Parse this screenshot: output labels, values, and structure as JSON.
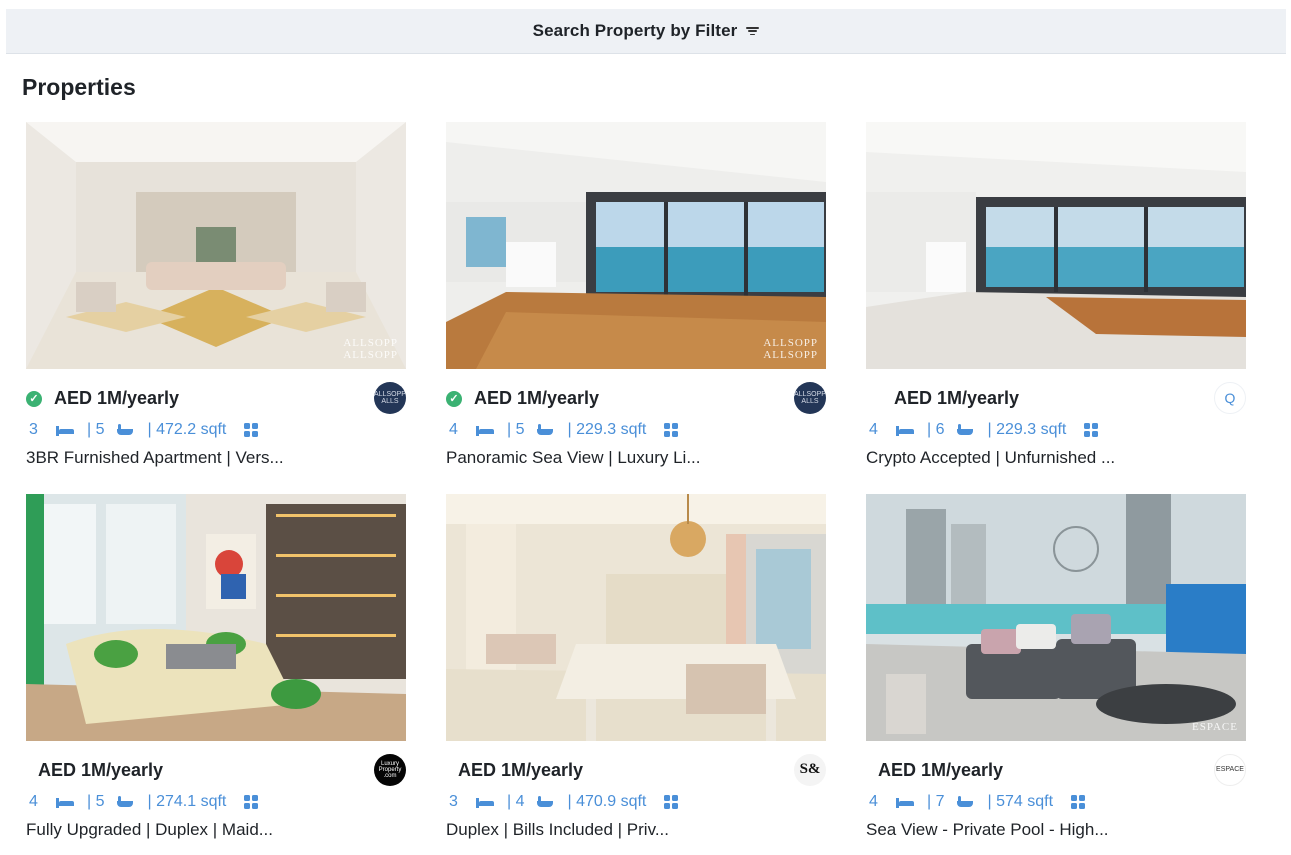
{
  "filter_bar": {
    "label": "Search Property by Filter",
    "icon": "filter-lines-icon"
  },
  "heading": "Properties",
  "accent_color": "#4a8fd8",
  "listings": [
    {
      "price": "AED 1M/yearly",
      "verified": true,
      "beds": "3",
      "baths": "| 5",
      "area": "| 472.2 sqft",
      "title": "3BR Furnished Apartment | Vers...",
      "agency_text": "ALLSOPP\nALLS",
      "photo_watermark": "ALLSOPP\nALLSOPP"
    },
    {
      "price": "AED 1M/yearly",
      "verified": true,
      "beds": "4",
      "baths": "| 5",
      "area": "| 229.3 sqft",
      "title": "Panoramic Sea View | Luxury Li...",
      "agency_text": "ALLSOPP\nALLS",
      "photo_watermark": "ALLSOPP\nALLSOPP"
    },
    {
      "price": "AED 1M/yearly",
      "verified": false,
      "beds": "4",
      "baths": "| 6",
      "area": "| 229.3 sqft",
      "title": "Crypto Accepted | Unfurnished ...",
      "agency_text": "Q",
      "photo_watermark": ""
    },
    {
      "price": "AED 1M/yearly",
      "verified": false,
      "beds": "4",
      "baths": "| 5",
      "area": "| 274.1 sqft",
      "title": "Fully Upgraded | Duplex | Maid...",
      "agency_text": "Luxury\nProperty\n.com",
      "photo_watermark": ""
    },
    {
      "price": "AED 1M/yearly",
      "verified": false,
      "beds": "3",
      "baths": "| 4",
      "area": "| 470.9 sqft",
      "title": "Duplex | Bills Included | Priv...",
      "agency_text": "S&",
      "photo_watermark": ""
    },
    {
      "price": "AED 1M/yearly",
      "verified": false,
      "beds": "4",
      "baths": "| 7",
      "area": "| 574 sqft",
      "title": "Sea View - Private Pool - High...",
      "agency_text": "ESPACE",
      "photo_watermark": "ESPACE"
    }
  ]
}
